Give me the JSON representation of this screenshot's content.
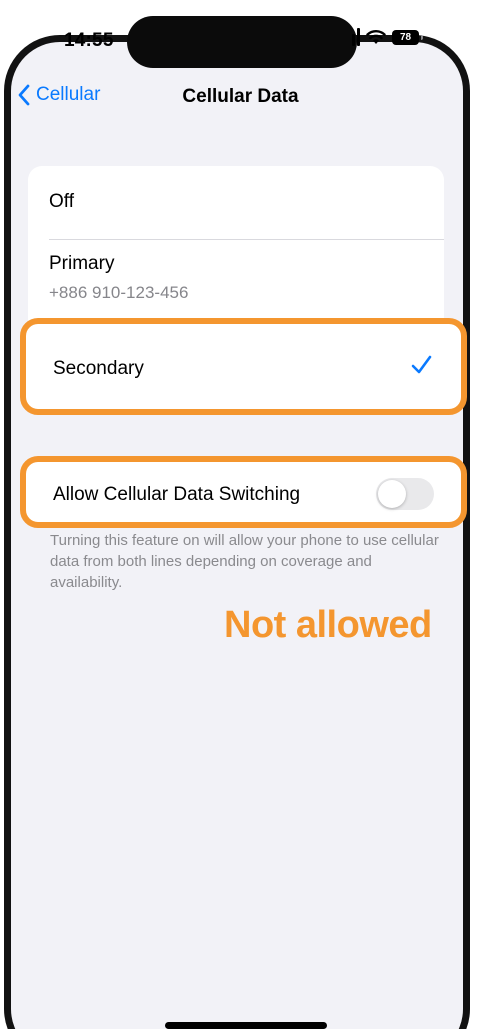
{
  "status_bar": {
    "time": "14:55",
    "battery_level": "78",
    "icons": [
      "signal-icon",
      "wifi-icon",
      "battery-icon"
    ]
  },
  "nav": {
    "back_label": "Cellular",
    "title": "Cellular Data"
  },
  "lines": {
    "off_label": "Off",
    "primary_label": "Primary",
    "primary_number": "+886 910-123-456",
    "secondary_label": "Secondary",
    "selected": "Secondary"
  },
  "switching": {
    "label": "Allow Cellular Data Switching",
    "enabled": false,
    "footnote": "Turning this feature on will allow your phone to use cellular data from both lines depending on coverage and availability."
  },
  "annotation": {
    "text": "Not allowed",
    "color": "#f4962f"
  },
  "colors": {
    "accent": "#0a7aff",
    "highlight": "#f4962f"
  }
}
